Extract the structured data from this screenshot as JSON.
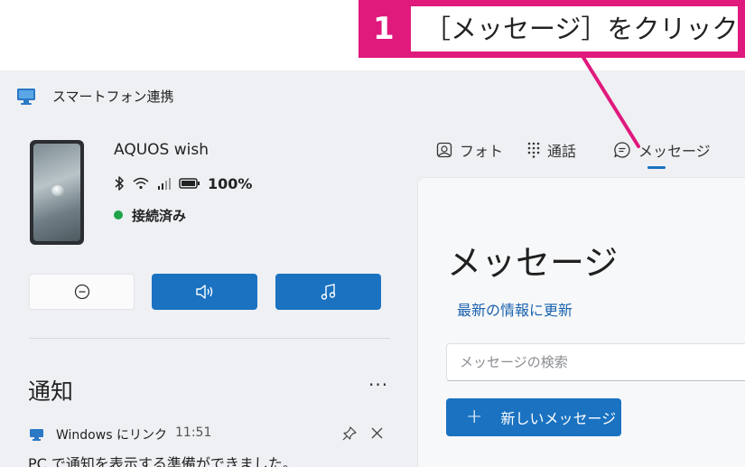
{
  "callout": {
    "step": "1",
    "text": "［メッセージ］をクリック",
    "color": "#e0197d"
  },
  "window": {
    "title": "スマートフォン連携",
    "app_icon": "phone-link-icon"
  },
  "device": {
    "name": "AQUOS wish",
    "battery": "100%",
    "status": "接続済み",
    "status_color": "#1fa34a",
    "icons": [
      "bluetooth-icon",
      "wifi-icon",
      "signal-icon",
      "battery-icon"
    ]
  },
  "controls": {
    "buttons": [
      {
        "name": "do-not-disturb-button",
        "icon": "minus-circle-icon"
      },
      {
        "name": "volume-button",
        "icon": "speaker-icon"
      },
      {
        "name": "music-button",
        "icon": "music-note-icon"
      }
    ],
    "accent": "#1a72c1"
  },
  "notifications": {
    "title": "通知",
    "more": "···",
    "item": {
      "app": "Windows にリンク",
      "time": "11:51",
      "body": "PC で通知を表示する準備ができました。"
    }
  },
  "tabs": [
    {
      "label": "フォト",
      "icon": "photo-icon"
    },
    {
      "label": "通話",
      "icon": "dialpad-icon"
    },
    {
      "label": "メッセージ",
      "icon": "chat-icon",
      "selected": true
    }
  ],
  "messages": {
    "heading": "メッセージ",
    "refresh": "最新の情報に更新",
    "search_placeholder": "メッセージの検索",
    "new_button": "新しいメッセージ",
    "new_button_icon": "plus-icon"
  }
}
